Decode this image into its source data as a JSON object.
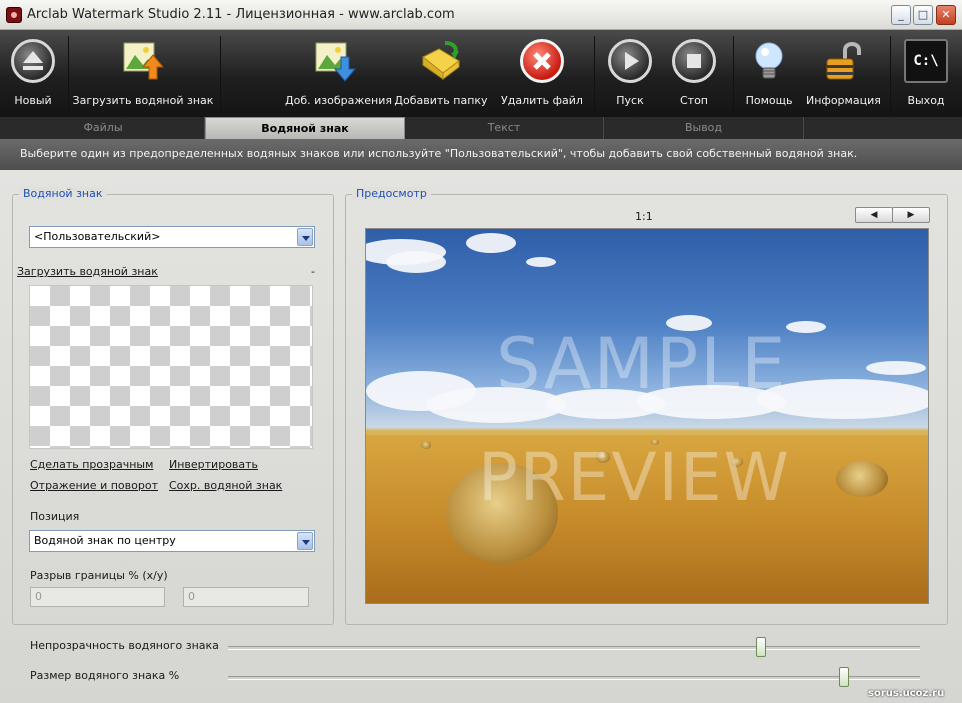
{
  "window": {
    "title": "Arclab Watermark Studio 2.11 - Лицензионная - www.arclab.com",
    "controls": [
      "_",
      "□",
      "✕"
    ]
  },
  "toolbar": {
    "new_label": "Новый",
    "load_watermark_label": "Загрузить водяной знак",
    "add_images_label": "Доб. изображения",
    "add_folder_label": "Добавить папку",
    "delete_file_label": "Удалить файл",
    "start_label": "Пуск",
    "stop_label": "Стоп",
    "help_label": "Помощь",
    "info_label": "Информация",
    "exit_label": "Выход",
    "exit_icon_text": "C:\\"
  },
  "tabs": [
    {
      "label": "Файлы",
      "active": false
    },
    {
      "label": "Водяной знак",
      "active": true
    },
    {
      "label": "Текст",
      "active": false
    },
    {
      "label": "Вывод",
      "active": false
    }
  ],
  "info_text": "Выберите один из предопределенных водяных знаков или используйте \"Пользовательский\", чтобы добавить свой собственный водяной знак.",
  "watermark_panel": {
    "group_title": "Водяной знак",
    "preset_value": "<Пользовательский>",
    "load_link": "Загрузить водяной знак",
    "load_dash": "-",
    "make_transparent": "Сделать прозрачным",
    "invert": "Инвертировать",
    "flip_rotate": "Отражение и поворот",
    "save_watermark": "Сохр. водяной знак",
    "position_label": "Позиция",
    "position_value": "Водяной знак по центру",
    "border_gap_label": "Разрыв границы % (x/y)",
    "gap_x": "0",
    "gap_y": "0"
  },
  "preview_panel": {
    "group_title": "Предосмотр",
    "zoom": "1:1",
    "prev": "◀",
    "next": "▶",
    "watermark_line1": "SAMPLE",
    "watermark_line2": "PREVIEW"
  },
  "sliders": {
    "opacity_label": "Непрозрачность водяного знака",
    "opacity_fraction": 0.77,
    "size_label": "Размер водяного знака %",
    "size_fraction": 0.89
  },
  "corner_watermark": "sorus.ucoz.ru",
  "colors": {
    "toolbar_bg": "#1f1f1f",
    "accent_blue": "#1f4fb5",
    "delete_red": "#c81a10"
  }
}
